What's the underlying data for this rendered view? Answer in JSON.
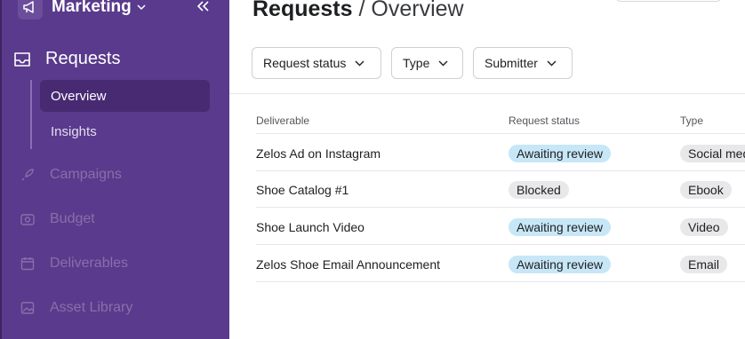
{
  "sidebar": {
    "workspace": "Marketing",
    "nav_main": "Requests",
    "sub_items": [
      "Overview",
      "Insights"
    ],
    "nav_items": [
      "Campaigns",
      "Budget",
      "Deliverables",
      "Asset Library"
    ]
  },
  "page": {
    "title": "Requests",
    "separator": "/",
    "subtitle": "Overview"
  },
  "filters": [
    "Request status",
    "Type",
    "Submitter"
  ],
  "table": {
    "headers": [
      "Deliverable",
      "Request status",
      "Type"
    ],
    "rows": [
      {
        "deliverable": "Zelos Ad on Instagram",
        "status": "Awaiting review",
        "type": "Social med"
      },
      {
        "deliverable": "Shoe Catalog #1",
        "status": "Blocked",
        "type": "Ebook"
      },
      {
        "deliverable": "Shoe Launch Video",
        "status": "Awaiting review",
        "type": "Video"
      },
      {
        "deliverable": "Zelos Shoe Email Announcement",
        "status": "Awaiting review",
        "type": "Email"
      }
    ]
  },
  "colors": {
    "sidebar_bg": "#5a3a8c",
    "sidebar_active": "#472a72",
    "status_awaiting": "#c7e7f7",
    "status_blocked": "#e8e8ea"
  }
}
